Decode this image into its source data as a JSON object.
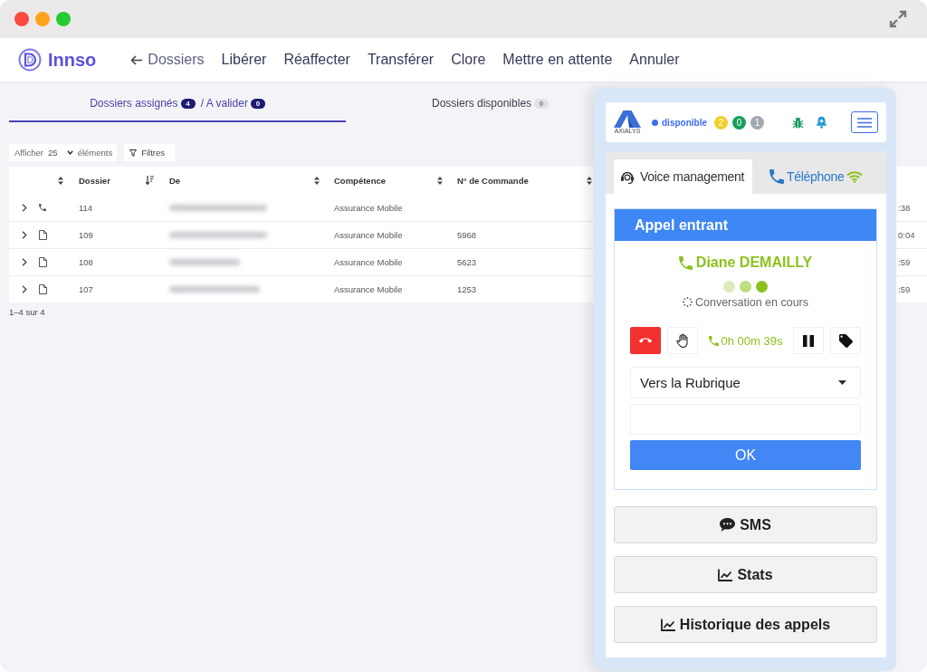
{
  "app": {
    "name": "Innso"
  },
  "toolbar": {
    "items": [
      {
        "label": "Dossiers",
        "kind": "back"
      },
      {
        "label": "Libérer",
        "kind": "action"
      },
      {
        "label": "Réaffecter",
        "kind": "action"
      },
      {
        "label": "Transférer",
        "kind": "action"
      },
      {
        "label": "Clore",
        "kind": "action"
      },
      {
        "label": "Mettre en attente",
        "kind": "action"
      },
      {
        "label": "Annuler",
        "kind": "action"
      }
    ]
  },
  "tabs": [
    {
      "label": "Dossiers assignés",
      "count": "4",
      "secondary_label": "/ A valider",
      "secondary_count": "0",
      "selected": true
    },
    {
      "label": "Dossiers disponibles",
      "count": "0",
      "selected": false
    }
  ],
  "list_controls": {
    "page_size": {
      "prefix": "Afficher",
      "value": "25",
      "suffix": "éléments"
    },
    "filter": {
      "label": "Filtres"
    }
  },
  "table": {
    "columns": [
      {
        "sorted": false
      },
      {
        "label": "Dossier",
        "sorted": true
      },
      {
        "label": "De",
        "sorted": false
      },
      {
        "label": "Compétence",
        "sorted": false
      },
      {
        "label": "N° de Commande",
        "sorted": false
      }
    ],
    "rows": [
      {
        "kind": "call",
        "expanded": false,
        "dossier": "114",
        "competence": "Assurance Mobile",
        "column_8": ":38"
      },
      {
        "kind": "document",
        "expanded": false,
        "dossier": "109",
        "competence": "Assurance Mobile",
        "order": "5968",
        "column_8": "0:04"
      },
      {
        "kind": "document",
        "expanded": false,
        "dossier": "108",
        "competence": "Assurance Mobile",
        "order": "5623",
        "column_8": ":59"
      },
      {
        "kind": "document",
        "expanded": false,
        "dossier": "107",
        "competence": "Assurance Mobile",
        "order": "1253",
        "column_8": ":59"
      }
    ]
  },
  "pagination": "1–4 sur 4",
  "softphone": {
    "brand": "AXIALYS",
    "status": "disponible",
    "counters": [
      {
        "value": "2",
        "color": "#f0cf2a"
      },
      {
        "value": "0",
        "color": "#16a05c"
      },
      {
        "value": "1",
        "color": "#a3a8b0"
      }
    ],
    "tabs": [
      {
        "label": "Voice management",
        "kind": "voice",
        "selected": true
      },
      {
        "label": "Téléphone",
        "kind": "phone",
        "selected": false
      }
    ],
    "call": {
      "title": "Appel entrant",
      "caller": "Diane DEMAILLY",
      "status": "Conversation en cours",
      "timer": "0h 00m 39s"
    },
    "routing": {
      "value": "Vers la Rubrique"
    },
    "submit": "OK",
    "actions": [
      {
        "label": "SMS",
        "kind": "sms"
      },
      {
        "label": "Stats",
        "kind": "stats"
      },
      {
        "label": "Historique des appels",
        "kind": "history"
      }
    ]
  }
}
